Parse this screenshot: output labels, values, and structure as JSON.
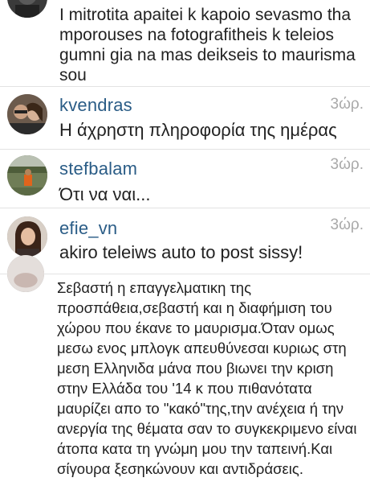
{
  "comments": [
    {
      "username": "",
      "time": "",
      "text": "I mitrotita apaitei k kapoio sevasmo tha mporouses na fotografitheis k teleios gumni gia na mas deikseis to maurisma sou"
    },
    {
      "username": "kvendras",
      "time": "3ώρ.",
      "text": "Η άχρηστη πληροφορία της ημέρας"
    },
    {
      "username": "stefbalam",
      "time": "3ώρ.",
      "text": "Ότι να ναι..."
    },
    {
      "username": "efie_vn",
      "time": "3ώρ.",
      "text": "akiro teleiws auto to post sissy!"
    },
    {
      "username": "",
      "time": "",
      "text": "Σεβαστή η επαγγελματικη της προσπάθεια,σεβαστή και η διαφήμιση του χώρου που έκανε το μαυρισμα.Όταν ομως μεσω ενος μπλογκ απευθύνεσαι κυριως στη μεση Ελληνιδα μάνα που βιωνει την κριση στην Ελλάδα του '14 κ που πιθανότατα μαυρίζει απο το \"κακό\"της,την ανέχεια ή την ανεργία της θέματα σαν το συγκεκριμενο είναι άτοπα κατα τη γνώμη μου την ταπεινή.Και σίγουρα ξεσηκώνουν και αντιδράσεις."
    }
  ]
}
